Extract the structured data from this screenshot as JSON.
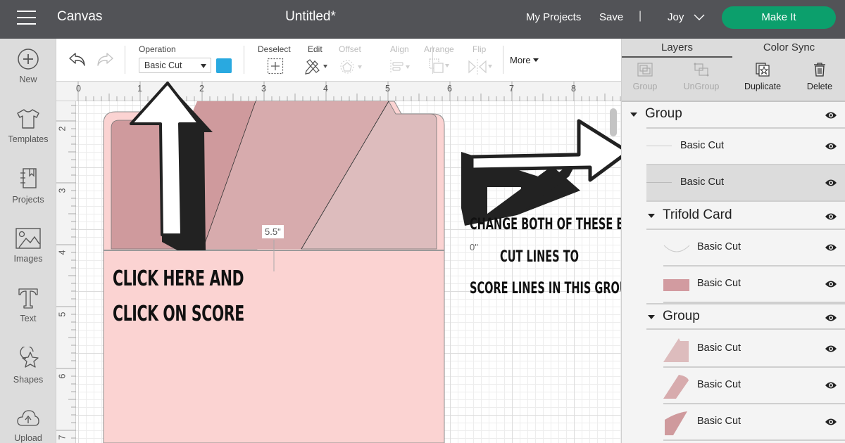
{
  "topbar": {
    "app_title": "Canvas",
    "doc_title": "Untitled*",
    "my_projects": "My Projects",
    "save": "Save",
    "separator": "|",
    "user": "Joy",
    "make_it": "Make It",
    "make_it_color": "#0c9f6c"
  },
  "sidebar": {
    "items": [
      {
        "label": "New",
        "icon": "plus-circle-icon"
      },
      {
        "label": "Templates",
        "icon": "tshirt-icon"
      },
      {
        "label": "Projects",
        "icon": "notebook-icon"
      },
      {
        "label": "Images",
        "icon": "image-icon"
      },
      {
        "label": "Text",
        "icon": "text-t-icon"
      },
      {
        "label": "Shapes",
        "icon": "shapes-icon"
      },
      {
        "label": "Upload",
        "icon": "cloud-upload-icon"
      }
    ]
  },
  "toolbar": {
    "operation_label": "Operation",
    "operation_value": "Basic Cut",
    "operation_color": "#29a9e0",
    "deselect": "Deselect",
    "edit": "Edit",
    "offset": "Offset",
    "align": "Align",
    "arrange": "Arrange",
    "flip": "Flip",
    "more": "More"
  },
  "canvas": {
    "ruler_top": [
      "0",
      "1",
      "2",
      "3",
      "4",
      "5",
      "6",
      "7",
      "8"
    ],
    "ruler_left": [
      "2",
      "3",
      "4",
      "5",
      "6",
      "7"
    ],
    "dimension_label": "5.5\"",
    "zero_label": "0\"",
    "colors": {
      "card_base": "#fbd3d2",
      "panel_dark": "#cf9a9d",
      "panel_mid": "#d7abad",
      "panel_light": "#ddbcbd"
    },
    "annotation_left": [
      "CLICK HERE AND",
      "CLICK ON SCORE"
    ],
    "annotation_right": [
      "CHANGE BOTH OF THESE BASIC",
      "CUT LINES TO",
      "SCORE LINES IN THIS GROUP"
    ]
  },
  "layers_panel": {
    "tabs": [
      {
        "label": "Layers",
        "active": true
      },
      {
        "label": "Color Sync",
        "active": false
      }
    ],
    "actions": [
      {
        "label": "Group",
        "enabled": false,
        "icon": "group-icon"
      },
      {
        "label": "UnGroup",
        "enabled": false,
        "icon": "ungroup-icon"
      },
      {
        "label": "Duplicate",
        "enabled": true,
        "icon": "duplicate-icon"
      },
      {
        "label": "Delete",
        "enabled": true,
        "icon": "trash-icon"
      }
    ],
    "tree": [
      {
        "type": "group",
        "label": "Group",
        "children": [
          {
            "label": "Basic Cut",
            "thumb": "line",
            "selected": false
          },
          {
            "label": "Basic Cut",
            "thumb": "line",
            "selected": true
          }
        ]
      },
      {
        "type": "group",
        "label": "Trifold Card",
        "children": [
          {
            "label": "Basic Cut",
            "thumb": "arc",
            "selected": false
          },
          {
            "label": "Basic Cut",
            "thumb": "rect",
            "color": "#d29ba0",
            "selected": false
          }
        ]
      },
      {
        "type": "group",
        "label": "Group",
        "children": [
          {
            "label": "Basic Cut",
            "thumb": "tab-shape",
            "color": "#ddbcbd",
            "selected": false
          },
          {
            "label": "Basic Cut",
            "thumb": "slant-shape",
            "color": "#d7abad",
            "selected": false
          },
          {
            "label": "Basic Cut",
            "thumb": "curve-shape",
            "color": "#cf9a9d",
            "selected": false
          }
        ]
      }
    ]
  }
}
